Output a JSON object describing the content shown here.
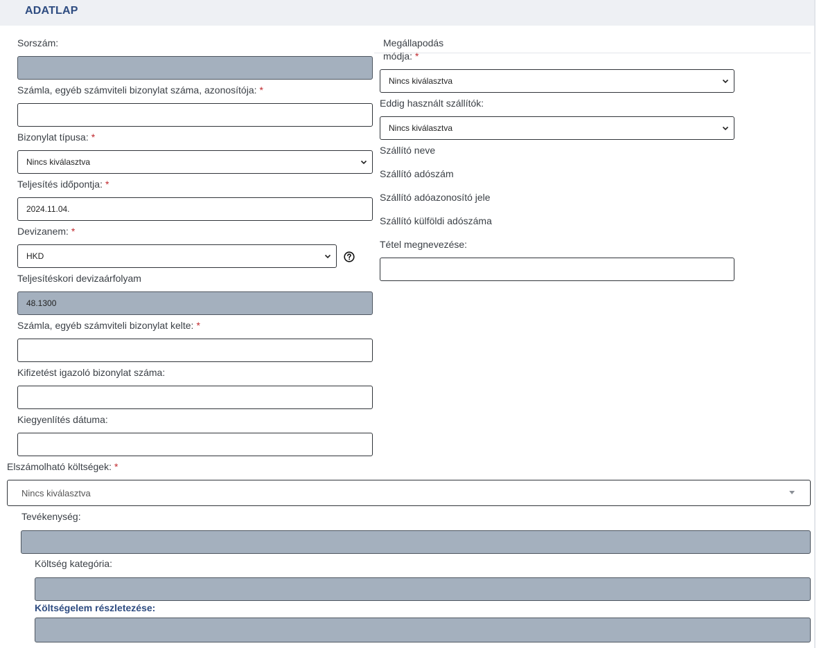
{
  "header": {
    "title": "ADATLAP"
  },
  "left": {
    "sorszam": {
      "label": "Sorszám:",
      "value": ""
    },
    "szamla_szam": {
      "label": "Számla, egyéb számviteli bizonylat száma, azonosítója:",
      "required": "*",
      "value": ""
    },
    "bizonylat_tipusa": {
      "label": "Bizonylat típusa:",
      "required": "*",
      "value": "Nincs kiválasztva"
    },
    "teljesites_idopontja": {
      "label": "Teljesítés időpontja:",
      "required": "*",
      "value": "2024.11.04."
    },
    "devizanem": {
      "label": "Devizanem:",
      "required": "*",
      "value": "HKD",
      "help_icon": "question-circle-icon"
    },
    "devizaarfolyam": {
      "label": "Teljesítéskori devizaárfolyam",
      "value": "48.1300"
    },
    "szamla_kelte": {
      "label": "Számla, egyéb számviteli bizonylat kelte:",
      "required": "*",
      "value": ""
    },
    "kifizetes_bizonylat": {
      "label": "Kifizetést igazoló bizonylat száma:",
      "value": ""
    },
    "kiegyenlites_datuma": {
      "label": "Kiegyenlítés dátuma:",
      "value": ""
    }
  },
  "right": {
    "megallapodas_modja": {
      "label": "Megállapodás módja:",
      "required": "*",
      "value": "Nincs kiválasztva"
    },
    "eddig_hasznalt": {
      "label": "Eddig használt szállítók:",
      "value": "Nincs kiválasztva"
    },
    "szallito_neve": {
      "label": "Szállító neve"
    },
    "szallito_adoszam": {
      "label": "Szállító adószám"
    },
    "szallito_adoazonosito": {
      "label": "Szállító adóazonosító jele"
    },
    "szallito_kulfoldi": {
      "label": "Szállító külföldi adószáma"
    },
    "tetel_megnevezese": {
      "label": "Tétel megnevezése:",
      "value": ""
    }
  },
  "bottom": {
    "elszamolhato": {
      "label": "Elszámolható költségek:",
      "required": "*",
      "value": "Nincs kiválasztva"
    },
    "tevekenyseg": {
      "label": "Tevékenység:",
      "value": ""
    },
    "koltseg_kategoria": {
      "label": "Költség kategória:",
      "value": ""
    },
    "koltsegelem": {
      "label": "Költségelem részletezése:",
      "value": ""
    }
  },
  "colors": {
    "accent": "#2d4b80",
    "required": "#c0282d",
    "disabled_bg": "#a4b0be"
  }
}
